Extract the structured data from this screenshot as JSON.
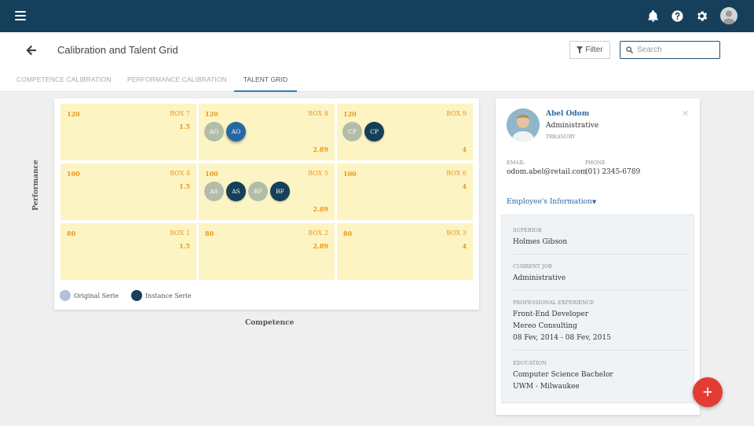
{
  "header": {
    "title": "Calibration and Talent Grid",
    "filter_label": "Filter",
    "search_placeholder": "Search"
  },
  "tabs": [
    {
      "label": "COMPETENCE CALIBRATION",
      "active": false
    },
    {
      "label": "PERFORMANCE CALIBRATION",
      "active": false
    },
    {
      "label": "TALENT GRID",
      "active": true
    }
  ],
  "grid": {
    "y_axis_label": "Performance",
    "x_axis_label": "Competence",
    "cells": [
      {
        "box": "BOX 7",
        "num": "120",
        "value": "1.5",
        "bubbles": []
      },
      {
        "box": "BOX 8",
        "num": "120",
        "value": "2.89",
        "bubbles": [
          {
            "initials": "AO",
            "type": "original"
          },
          {
            "initials": "AO",
            "type": "selected"
          }
        ]
      },
      {
        "box": "BOX 9",
        "num": "120",
        "value": "4",
        "bubbles": [
          {
            "initials": "CP",
            "type": "original"
          },
          {
            "initials": "CP",
            "type": "instance"
          }
        ]
      },
      {
        "box": "BOX 4",
        "num": "100",
        "value": "1.5",
        "bubbles": []
      },
      {
        "box": "BOX 5",
        "num": "100",
        "value": "2.89",
        "bubbles": [
          {
            "initials": "AS",
            "type": "original"
          },
          {
            "initials": "AS",
            "type": "instance"
          },
          {
            "initials": "BF",
            "type": "original"
          },
          {
            "initials": "BF",
            "type": "instance"
          }
        ]
      },
      {
        "box": "BOX 6",
        "num": "100",
        "value": "4",
        "bubbles": []
      },
      {
        "box": "BOX 1",
        "num": "80",
        "value": "1.5",
        "bubbles": []
      },
      {
        "box": "BOX 2",
        "num": "80",
        "value": "2.89",
        "bubbles": []
      },
      {
        "box": "BOX 3",
        "num": "80",
        "value": "4",
        "bubbles": []
      }
    ],
    "legend": [
      {
        "label": "Original Serie",
        "color": "#b3c2d5"
      },
      {
        "label": "Instance Serie",
        "color": "#153f5a"
      }
    ]
  },
  "profile": {
    "name": "Abel Odom",
    "role": "Administrative",
    "department": "TREASURY",
    "email_label": "EMAIL",
    "email": "odom.abel@retail.com",
    "phone_label": "PHONE",
    "phone": "(01) 2345-6789",
    "employee_info_label": "Employee's Information",
    "superior_label": "SUPERIOR",
    "superior": "Holmes Gibson",
    "current_job_label": "CURRENT JOB",
    "current_job": "Administrative",
    "experience_label": "PROFESSIONAL EXPERIENCE",
    "experience": [
      "Front-End Developer",
      "Mereo Consulting",
      "08 Fev, 2014 - 08 Fev, 2015"
    ],
    "education_label": "EDUCATION",
    "education": [
      "Computer Science Bachelor",
      "UWM - Milwaukee"
    ]
  },
  "fab_label": "+",
  "colors": {
    "topbar": "#153f5a",
    "accent": "#2b6aa5",
    "cell": "#fdf4c3",
    "cell_text": "#e8971e",
    "fab": "#e33d33"
  }
}
